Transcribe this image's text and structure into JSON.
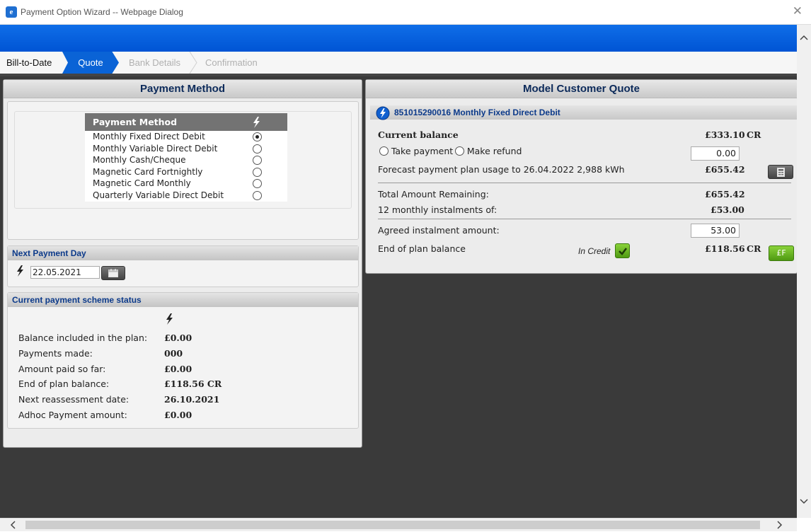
{
  "window": {
    "title": "Payment Option Wizard -- Webpage Dialog",
    "close_glyph": "✕",
    "app_icon_glyph": "e"
  },
  "breadcrumb": [
    {
      "label": "Bill-to-Date",
      "state": "done"
    },
    {
      "label": "Quote",
      "state": "active"
    },
    {
      "label": "Bank Details",
      "state": "todo"
    },
    {
      "label": "Confirmation",
      "state": "todo"
    }
  ],
  "payment_method": {
    "title": "Payment Method",
    "table_header": "Payment Method",
    "header_icon": "lightning-bolt-icon",
    "options": [
      {
        "label": "Monthly Fixed Direct Debit",
        "selected": true
      },
      {
        "label": "Monthly Variable Direct Debit",
        "selected": false
      },
      {
        "label": "Monthly Cash/Cheque",
        "selected": false
      },
      {
        "label": "Magnetic Card Fortnightly",
        "selected": false
      },
      {
        "label": "Magnetic Card Monthly",
        "selected": false
      },
      {
        "label": "Quarterly Variable Direct Debit",
        "selected": false
      }
    ]
  },
  "next_payment_day": {
    "title": "Next Payment Day",
    "date": "22.05.2021",
    "icon": "lightning-bolt-icon",
    "calendar_icon": "calendar-icon"
  },
  "scheme_status": {
    "title": "Current payment scheme status",
    "icon": "lightning-bolt-icon",
    "rows": [
      {
        "label": "Balance included in the plan:",
        "value": "£0.00"
      },
      {
        "label": "Payments made:",
        "value": "000"
      },
      {
        "label": "Amount paid so far:",
        "value": "£0.00"
      },
      {
        "label": "End of plan balance:",
        "value": "£118.56 CR"
      },
      {
        "label": "Next reassessment date:",
        "value": "26.10.2021"
      },
      {
        "label": "Adhoc Payment amount:",
        "value": "£0.00"
      }
    ]
  },
  "quote": {
    "title": "Model Customer Quote",
    "account_header": "851015290016 Monthly Fixed Direct Debit",
    "current_balance_label": "Current balance",
    "current_balance_value": "£333.10",
    "current_balance_suffix": "CR",
    "take_payment_label": "Take payment",
    "make_refund_label": "Make refund",
    "payment_amount": "0.00",
    "forecast_label": "Forecast payment plan usage to 26.04.2022 2,988 kWh",
    "forecast_value": "£655.42",
    "total_remaining_label": "Total Amount Remaining:",
    "total_remaining_value": "£655.42",
    "instalments_label": "12 monthly instalments of:",
    "instalments_value": "£53.00",
    "agreed_label": "Agreed instalment amount:",
    "agreed_value": "53.00",
    "end_balance_label": "End of plan balance",
    "in_credit_label": "In Credit",
    "end_balance_value": "£118.56",
    "end_balance_suffix": "CR",
    "green_button_label": "£F"
  }
}
